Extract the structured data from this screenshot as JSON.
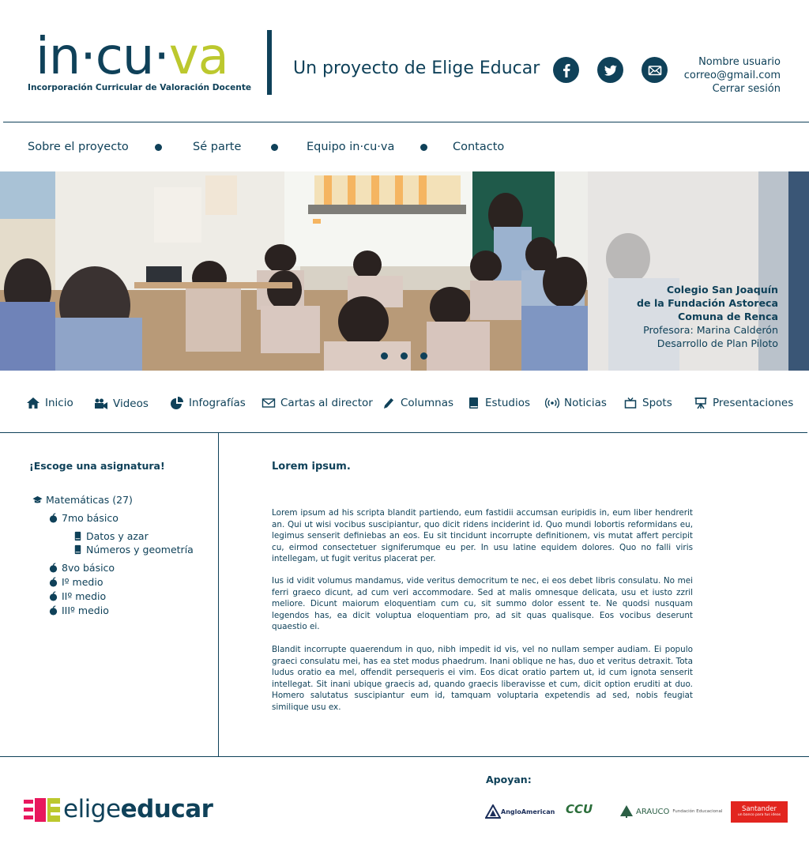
{
  "header": {
    "logo": {
      "part1": "in·cu·",
      "part2": "va",
      "subtitle": "Incorporación Curricular de Valoración Docente"
    },
    "tagline": "Un proyecto de Elige Educar",
    "social": [
      "facebook-icon",
      "twitter-icon",
      "mail-icon"
    ],
    "user": {
      "name": "Nombre usuario",
      "email": "correo@gmail.com",
      "logout": "Cerrar sesión"
    }
  },
  "topnav": [
    {
      "label": "Sobre el proyecto"
    },
    {
      "label": "Sé parte"
    },
    {
      "label": "Equipo in·cu·va"
    },
    {
      "label": "Contacto"
    }
  ],
  "hero": {
    "caption": {
      "line1": "Colegio San Joaquín",
      "line2": "de la Fundación Astoreca",
      "line3": "Comuna de Renca",
      "line4": "Profesora: Marina Calderón",
      "line5": "Desarrollo de Plan Piloto"
    },
    "slide_count": 3
  },
  "sectionnav": [
    {
      "label": "Inicio",
      "icon": "home-icon"
    },
    {
      "label": "Videos",
      "icon": "video-camera-icon"
    },
    {
      "label": "Infografías",
      "icon": "pie-chart-icon"
    },
    {
      "label": "Cartas al director",
      "icon": "envelope-icon"
    },
    {
      "label": "Columnas",
      "icon": "pencil-icon"
    },
    {
      "label": "Estudios",
      "icon": "book-icon"
    },
    {
      "label": "Noticias",
      "icon": "broadcast-icon"
    },
    {
      "label": "Spots",
      "icon": "tv-icon"
    },
    {
      "label": "Presentaciones",
      "icon": "presentation-icon"
    }
  ],
  "sidebar": {
    "title": "¡Escoge una asignatura!",
    "subject": "Matemáticas (27)",
    "levels": {
      "l1": "7mo básico",
      "l1_topics": [
        "Datos y azar",
        "Números y geometría"
      ],
      "l2": "8vo básico",
      "l3": "Iº medio",
      "l4": "IIº medio",
      "l5": "IIIº medio"
    }
  },
  "content": {
    "title": "Lorem ipsum.",
    "paragraphs": [
      "Lorem ipsum ad his scripta blandit partiendo, eum fastidii accumsan euripidis in, eum liber hendrerit an. Qui ut wisi vocibus suscipiantur, quo dicit ridens inciderint id. Quo mundi lobortis reformidans eu, legimus senserit definiebas an eos. Eu sit tincidunt incorrupte definitionem, vis mutat affert percipit cu, eirmod consectetuer signiferumque eu per. In usu latine equidem dolores. Quo no falli viris intellegam, ut fugit veritus placerat per.",
      "Ius id vidit volumus mandamus, vide veritus democritum te nec, ei eos debet libris consulatu. No mei ferri graeco dicunt, ad cum veri accommodare. Sed at malis omnesque delicata, usu et iusto zzril meliore. Dicunt maiorum eloquentiam cum cu, sit summo dolor essent te. Ne quodsi nusquam legendos has, ea dicit voluptua eloquentiam pro, ad sit quas qualisque. Eos vocibus deserunt quaestio ei.",
      "Blandit incorrupte quaerendum in quo, nibh impedit id vis, vel no nullam semper audiam. Ei populo graeci consulatu mei, has ea stet modus phaedrum. Inani oblique ne has, duo et veritus detraxit. Tota ludus oratio ea mel, offendit persequeris ei vim. Eos dicat oratio partem ut, id cum ignota senserit intellegat. Sit inani ubique graecis ad, quando graecis liberavisse et cum, dicit option eruditi at duo. Homero salutatus suscipiantur eum id, tamquam voluptaria expetendis ad sed, nobis feugiat similique usu ex."
    ]
  },
  "footer": {
    "logo": {
      "part1": "elige",
      "part2": "educar"
    },
    "supporters_label": "Apoyan:",
    "sponsors": {
      "anglo": "AngloAmerican",
      "ccu": "CCU",
      "arauco": "ARAUCO",
      "arauco_sub": "Fundación Educacional",
      "santander": "Santander",
      "santander_sub": "un banco para tus ideas"
    }
  },
  "colors": {
    "primary": "#0f4159",
    "accent": "#bcc82e",
    "brand_pink": "#e8175d"
  }
}
